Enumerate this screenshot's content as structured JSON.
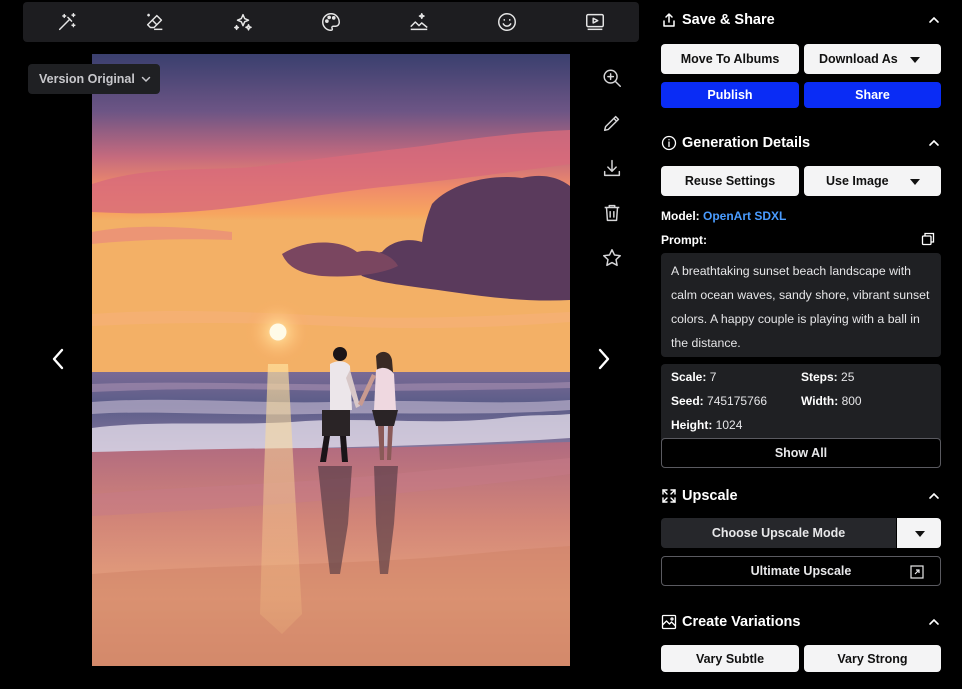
{
  "toolbar": {
    "tools": [
      "magic-wand-icon",
      "eraser-icon",
      "sparkles-icon",
      "palette-icon",
      "image-edit-icon",
      "smiley-icon",
      "video-icon"
    ]
  },
  "viewer": {
    "version_label": "Version Original",
    "side_tools": [
      "zoom-in-icon",
      "pencil-icon",
      "download-icon",
      "trash-icon",
      "star-icon"
    ]
  },
  "save_share": {
    "title": "Save & Share",
    "move_label": "Move To Albums",
    "download_label": "Download As",
    "publish_label": "Publish",
    "share_label": "Share"
  },
  "generation": {
    "title": "Generation Details",
    "reuse_label": "Reuse Settings",
    "use_image_label": "Use Image",
    "model_key": "Model:",
    "model_value": "OpenArt SDXL",
    "prompt_key": "Prompt:",
    "prompt_text": "A breathtaking sunset beach landscape with calm ocean waves, sandy shore, vibrant sunset colors. A happy couple is playing with a ball in the distance.",
    "scale_key": "Scale:",
    "scale_value": "7",
    "steps_key": "Steps:",
    "steps_value": "25",
    "seed_key": "Seed:",
    "seed_value": "745175766",
    "width_key": "Width:",
    "width_value": "800",
    "height_key": "Height:",
    "height_value": "1024",
    "show_all_label": "Show All"
  },
  "upscale": {
    "title": "Upscale",
    "choose_label": "Choose Upscale Mode",
    "ultimate_label": "Ultimate Upscale"
  },
  "variations": {
    "title": "Create Variations",
    "subtle_label": "Vary Subtle",
    "strong_label": "Vary Strong"
  },
  "colors": {
    "accent_blue": "#0a2cf5",
    "link_blue": "#4a9cff",
    "panel_dark": "#1f2023"
  }
}
